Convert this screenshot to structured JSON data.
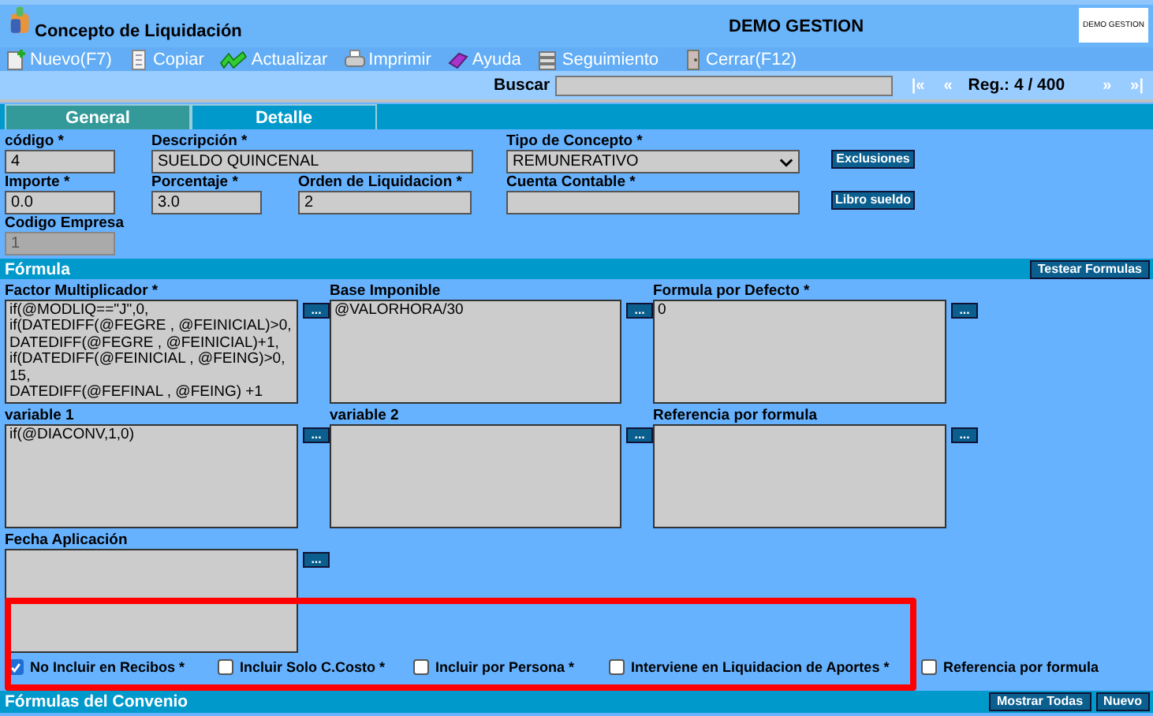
{
  "window": {
    "title": "Concepto de Liquidación",
    "company": "DEMO GESTION",
    "logo_text": "DEMO GESTION"
  },
  "toolbar": [
    {
      "label": "Nuevo(F7)",
      "kind": "new"
    },
    {
      "label": "Copiar",
      "kind": "copy"
    },
    {
      "label": "Actualizar",
      "kind": "refresh"
    },
    {
      "label": "Imprimir",
      "kind": "print"
    },
    {
      "label": "Ayuda",
      "kind": "help"
    },
    {
      "label": "Seguimiento",
      "kind": "track"
    },
    {
      "label": "Cerrar(F12)",
      "kind": "close"
    }
  ],
  "search": {
    "label": "Buscar"
  },
  "nav": {
    "first": "|«",
    "prev": "«",
    "record": "Reg.: 4 / 400",
    "next": "»",
    "last": "»|"
  },
  "tabs": [
    {
      "label": "General",
      "selected": true
    },
    {
      "label": "Detalle",
      "selected": false
    }
  ],
  "rows": [
    {
      "fields": [
        {
          "label": "código *",
          "value": "4",
          "kind": "text",
          "disabled": false
        },
        {
          "label": "Descripción *",
          "value": "SUELDO QUINCENAL",
          "kind": "text",
          "disabled": false
        },
        {
          "label": "Tipo de Concepto *",
          "value": "REMUNERATIVO",
          "kind": "select",
          "disabled": false
        }
      ],
      "button": "Exclusiones"
    },
    {
      "fields": [
        {
          "label": "Importe *",
          "value": "0.0",
          "kind": "text",
          "disabled": false
        },
        {
          "label": "Porcentaje *",
          "value": "3.0",
          "kind": "text",
          "disabled": false
        },
        {
          "label": "Orden de Liquidacion *",
          "value": "2",
          "kind": "text",
          "disabled": false
        },
        {
          "label": "Cuenta Contable *",
          "kind": "text",
          "disabled": false
        }
      ],
      "button": "Libro sueldo"
    },
    {
      "fields": [
        {
          "label": "Codigo Empresa",
          "value": "1",
          "kind": "text",
          "disabled": true
        }
      ]
    }
  ],
  "formula": {
    "title": "Fórmula",
    "button": "Testear Formulas",
    "boxes": [
      {
        "label": "Factor Multiplicador *",
        "value": "if(@MODLIQ==\"J\",0,\nif(DATEDIFF(@FEGRE , @FEINICIAL)>0,\nDATEDIFF(@FEGRE , @FEINICIAL)+1,\nif(DATEDIFF(@FEINICIAL , @FEING)>0,\n15,\nDATEDIFF(@FEFINAL , @FEING) +1",
        "button": "..."
      },
      {
        "label": "Base Imponible",
        "value": "@VALORHORA/30",
        "button": "..."
      },
      {
        "label": "Formula por Defecto *",
        "value": "0",
        "button": "..."
      },
      {
        "label": "variable 1",
        "value": "if(@DIACONV,1,0)",
        "button": "..."
      },
      {
        "label": "variable 2",
        "button": "..."
      },
      {
        "label": "Referencia por formula",
        "button": "..."
      },
      {
        "label": "Fecha Aplicación",
        "button": "..."
      }
    ]
  },
  "checkboxes": [
    {
      "label": "No Incluir en Recibos *",
      "checked": true
    },
    {
      "label": "Incluir Solo C.Costo *",
      "checked": false
    },
    {
      "label": "Incluir por Persona *",
      "checked": false
    },
    {
      "label": "Interviene en Liquidacion de Aportes *",
      "checked": false
    },
    {
      "label": "Referencia por formula",
      "checked": false
    }
  ],
  "footer": {
    "title": "Fórmulas del Convenio",
    "buttons": [
      "Mostrar Todas",
      "Nuevo"
    ]
  }
}
